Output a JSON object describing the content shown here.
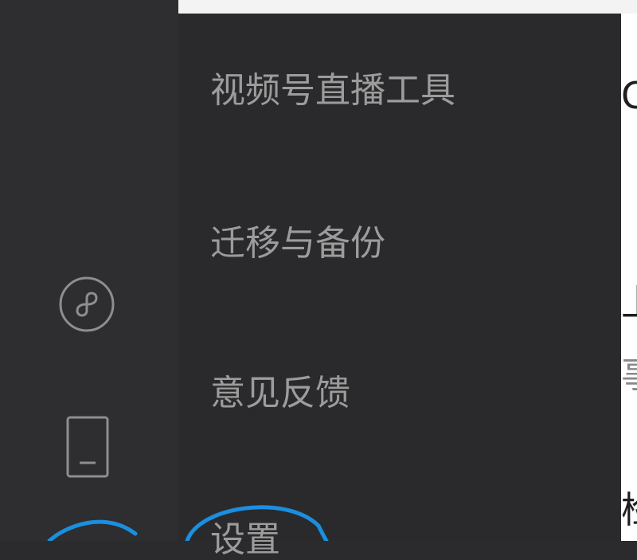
{
  "menu": {
    "items": [
      {
        "label": "视频号直播工具"
      },
      {
        "label": "迁移与备份"
      },
      {
        "label": "意见反馈"
      },
      {
        "label": "设置"
      }
    ]
  },
  "sidebar": {
    "icons": [
      "mini-program-icon",
      "phone-icon"
    ]
  },
  "right_edge": {
    "glyphs": [
      "C",
      "上",
      "事",
      "检"
    ]
  },
  "colors": {
    "sidebar_bg": "#2e2d2f",
    "menu_bg": "#2a2a2c",
    "menu_text": "#9c9c9c",
    "annotation": "#1a8fe0"
  }
}
